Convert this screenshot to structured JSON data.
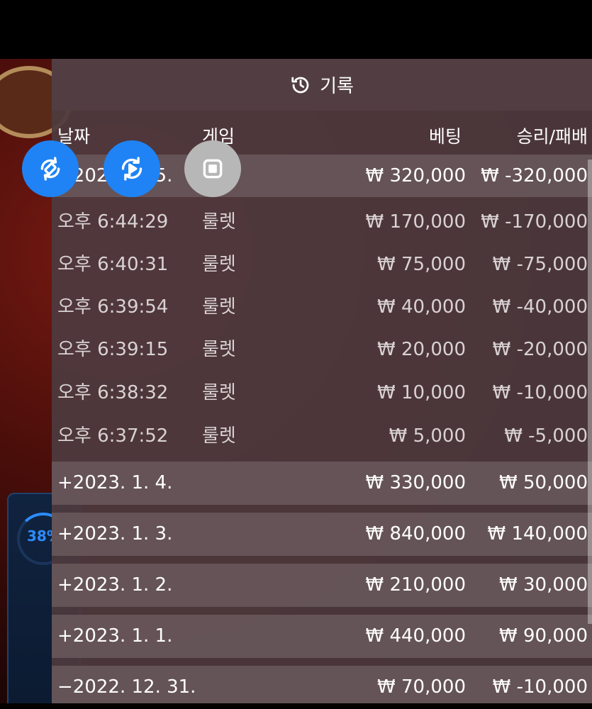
{
  "panel": {
    "title": "기록",
    "columns": {
      "date": "날짜",
      "game": "게임",
      "bet": "베팅",
      "winloss": "승리/패배"
    }
  },
  "progress": {
    "label": "38%"
  },
  "rows": [
    {
      "date": "−2023. 1. 5.",
      "game": "",
      "bet": "₩ 320,000",
      "winloss": "₩ -320,000"
    },
    {
      "date": "오후 6:44:29",
      "game": "룰렛",
      "bet": "₩ 170,000",
      "winloss": "₩ -170,000"
    },
    {
      "date": "오후 6:40:31",
      "game": "룰렛",
      "bet": "₩ 75,000",
      "winloss": "₩ -75,000"
    },
    {
      "date": "오후 6:39:54",
      "game": "룰렛",
      "bet": "₩ 40,000",
      "winloss": "₩ -40,000"
    },
    {
      "date": "오후 6:39:15",
      "game": "룰렛",
      "bet": "₩ 20,000",
      "winloss": "₩ -20,000"
    },
    {
      "date": "오후 6:38:32",
      "game": "룰렛",
      "bet": "₩ 10,000",
      "winloss": "₩ -10,000"
    },
    {
      "date": "오후 6:37:52",
      "game": "룰렛",
      "bet": "₩ 5,000",
      "winloss": "₩ -5,000"
    },
    {
      "date": "+2023. 1. 4.",
      "game": "",
      "bet": "₩ 330,000",
      "winloss": "₩ 50,000"
    },
    {
      "date": "+2023. 1. 3.",
      "game": "",
      "bet": "₩ 840,000",
      "winloss": "₩ 140,000"
    },
    {
      "date": "+2023. 1. 2.",
      "game": "",
      "bet": "₩ 210,000",
      "winloss": "₩ 30,000"
    },
    {
      "date": "+2023. 1. 1.",
      "game": "",
      "bet": "₩ 440,000",
      "winloss": "₩ 90,000"
    },
    {
      "date": "−2022. 12. 31.",
      "game": "",
      "bet": "₩ 70,000",
      "winloss": "₩ -10,000"
    }
  ],
  "icons": {
    "history": "history-icon",
    "fab1": "rotate-screen-icon",
    "fab2": "replay-icon",
    "fab3": "stop-icon"
  },
  "colors": {
    "accent": "#1f83f5",
    "panel": "#4e3a3e"
  }
}
